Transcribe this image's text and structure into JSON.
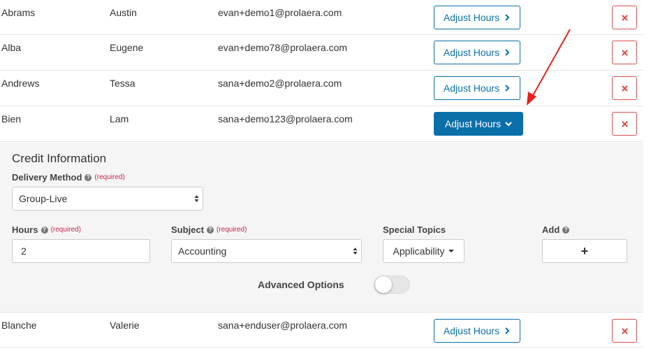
{
  "rows_top": [
    {
      "last": "Abrams",
      "first": "Austin",
      "email": "evan+demo1@prolaera.com",
      "button": "Adjust Hours"
    },
    {
      "last": "Alba",
      "first": "Eugene",
      "email": "evan+demo78@prolaera.com",
      "button": "Adjust Hours"
    },
    {
      "last": "Andrews",
      "first": "Tessa",
      "email": "sana+demo2@prolaera.com",
      "button": "Adjust Hours"
    },
    {
      "last": "Bien",
      "first": "Lam",
      "email": "sana+demo123@prolaera.com",
      "button": "Adjust Hours"
    }
  ],
  "credit_info": {
    "title": "Credit Information",
    "delivery_method": {
      "label": "Delivery Method",
      "required": "(required)",
      "value": "Group-Live"
    },
    "hours": {
      "label": "Hours",
      "required": "(required)",
      "value": "2"
    },
    "subject": {
      "label": "Subject",
      "required": "(required)",
      "value": "Accounting"
    },
    "special_topics": {
      "label": "Special Topics",
      "value": "Applicability"
    },
    "add": {
      "label": "Add",
      "button": "+"
    },
    "advanced_options": {
      "label": "Advanced Options",
      "enabled": false
    }
  },
  "rows_bottom": [
    {
      "last": "Blanche",
      "first": "Valerie",
      "email": "sana+enduser@prolaera.com",
      "button": "Adjust Hours"
    }
  ],
  "colors": {
    "primary": "#0b6fa9",
    "danger": "#d9534f",
    "annotation": "#e8201f"
  }
}
